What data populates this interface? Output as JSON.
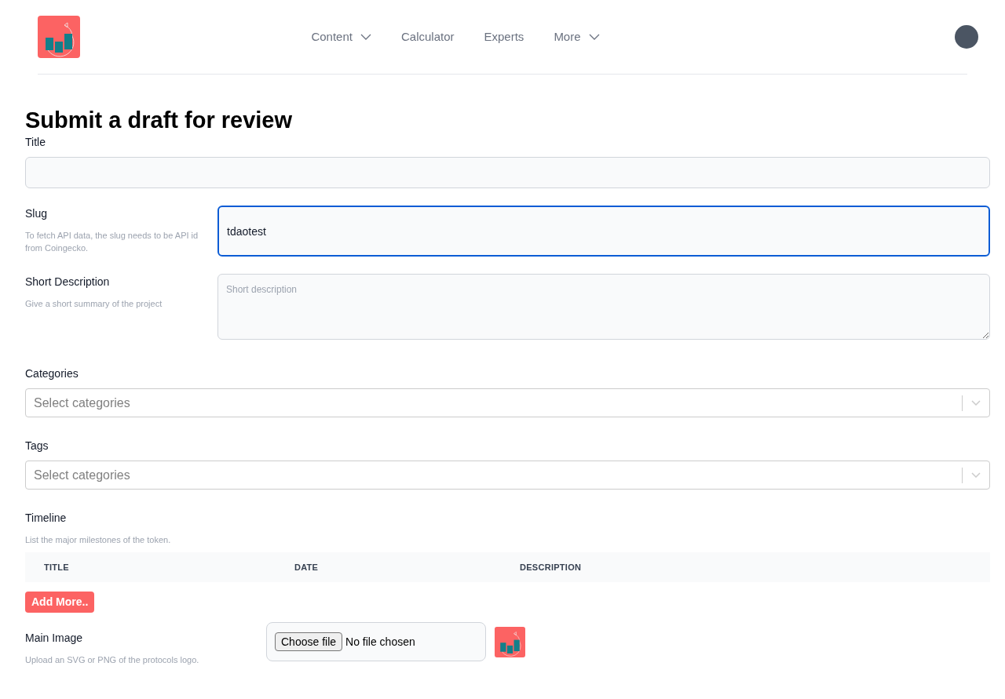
{
  "nav": [
    {
      "label": "Content",
      "has_menu": true
    },
    {
      "label": "Calculator",
      "has_menu": false
    },
    {
      "label": "Experts",
      "has_menu": false
    },
    {
      "label": "More",
      "has_menu": true
    }
  ],
  "heading": "Submit a draft for review",
  "fields": [
    {
      "kind": "text",
      "label": "Title"
    },
    {
      "kind": "text",
      "label": "Slug",
      "hint": "To fetch API data, the slug needs to be API id from Coingecko.",
      "value": "tdaotest",
      "focused": true
    },
    {
      "kind": "textarea",
      "label": "Short Description",
      "hint": "Give a short summary of the project",
      "placeholder": "Short description",
      "focused": false
    },
    {
      "kind": "select",
      "label": "Categories",
      "placeholder": "Select categories"
    },
    {
      "kind": "select",
      "label": "Tags",
      "placeholder": "Select categories"
    },
    {
      "kind": "table",
      "label": "Timeline",
      "hint": "List the major milestones of the token.",
      "columns": [
        "TITLE",
        "DATE",
        "DESCRIPTION"
      ],
      "button": "Add More.."
    },
    {
      "kind": "file",
      "label": "Main Image",
      "hint": "Upload an SVG or PNG of the protocols logo.",
      "button": "Choose file",
      "status": "No file chosen"
    }
  ]
}
